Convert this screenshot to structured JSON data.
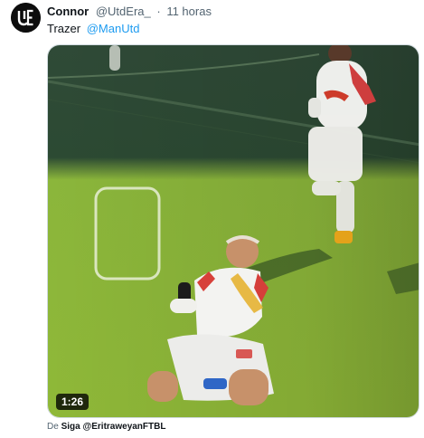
{
  "tweet": {
    "author_name": "Connor",
    "author_handle": "@UtdEra_",
    "separator": "·",
    "timestamp": "11 horas",
    "text": "Trazer",
    "mention": "@ManUtd",
    "avatar_icon": "ue-monogram-logo"
  },
  "media": {
    "type": "video",
    "duration": "1:26"
  },
  "attribution": {
    "prefix": "De",
    "link": "Siga @EritraweyanFTBL"
  }
}
